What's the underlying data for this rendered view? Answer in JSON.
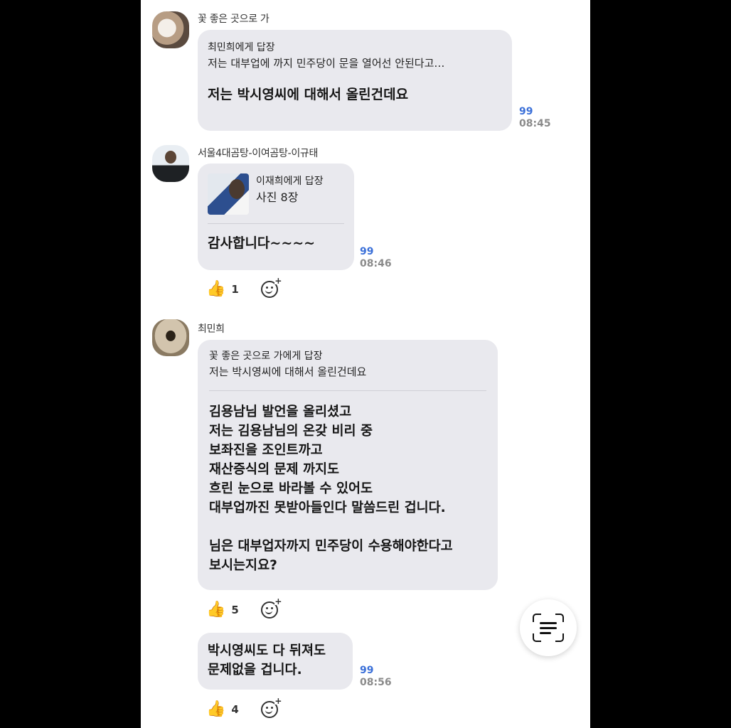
{
  "messages": [
    {
      "sender": "꽃 좋은 곳으로 가",
      "reply_to": "최민희에게 답장",
      "quote": "저는 대부업에 까지 민주당이 문을 열어선 안된다고…",
      "body": "저는 박시영씨에 대해서 올린건데요",
      "unread": "99",
      "time": "08:45"
    },
    {
      "sender": "서울4대곰탕-이여곰탕-이규태",
      "reply_to": "이재희에게 답장",
      "quote": "사진 8장",
      "body": "감사합니다~~~~",
      "unread": "99",
      "time": "08:46",
      "reaction_count": "1"
    },
    {
      "sender": "최민희",
      "reply_to": "꽃 좋은 곳으로 가에게 답장",
      "quote": "저는 박시영씨에 대해서 올린건데요",
      "body": "김용남님 발언을 올리셨고\n저는 김용남님의 온갖 비리 중\n보좌진을 조인트까고\n재산증식의 문제 까지도\n흐린 눈으로 바라볼 수 있어도\n대부업까진 못받아들인다 말씀드린 겁니다.\n\n님은 대부업자까지 민주당이 수용해야한다고\n보시는지요?",
      "reaction_count": "5"
    },
    {
      "body": "박시영씨도 다 뒤져도\n문제없을 겁니다.",
      "unread": "99",
      "time": "08:56",
      "reaction_count": "4"
    }
  ],
  "icons": {
    "thumbs_up": "thumbs-up-icon",
    "add_reaction": "add-reaction-icon",
    "text_scan": "text-scan-icon"
  },
  "colors": {
    "bubble": "#e9e9ee",
    "unread": "#3a6fd8"
  }
}
